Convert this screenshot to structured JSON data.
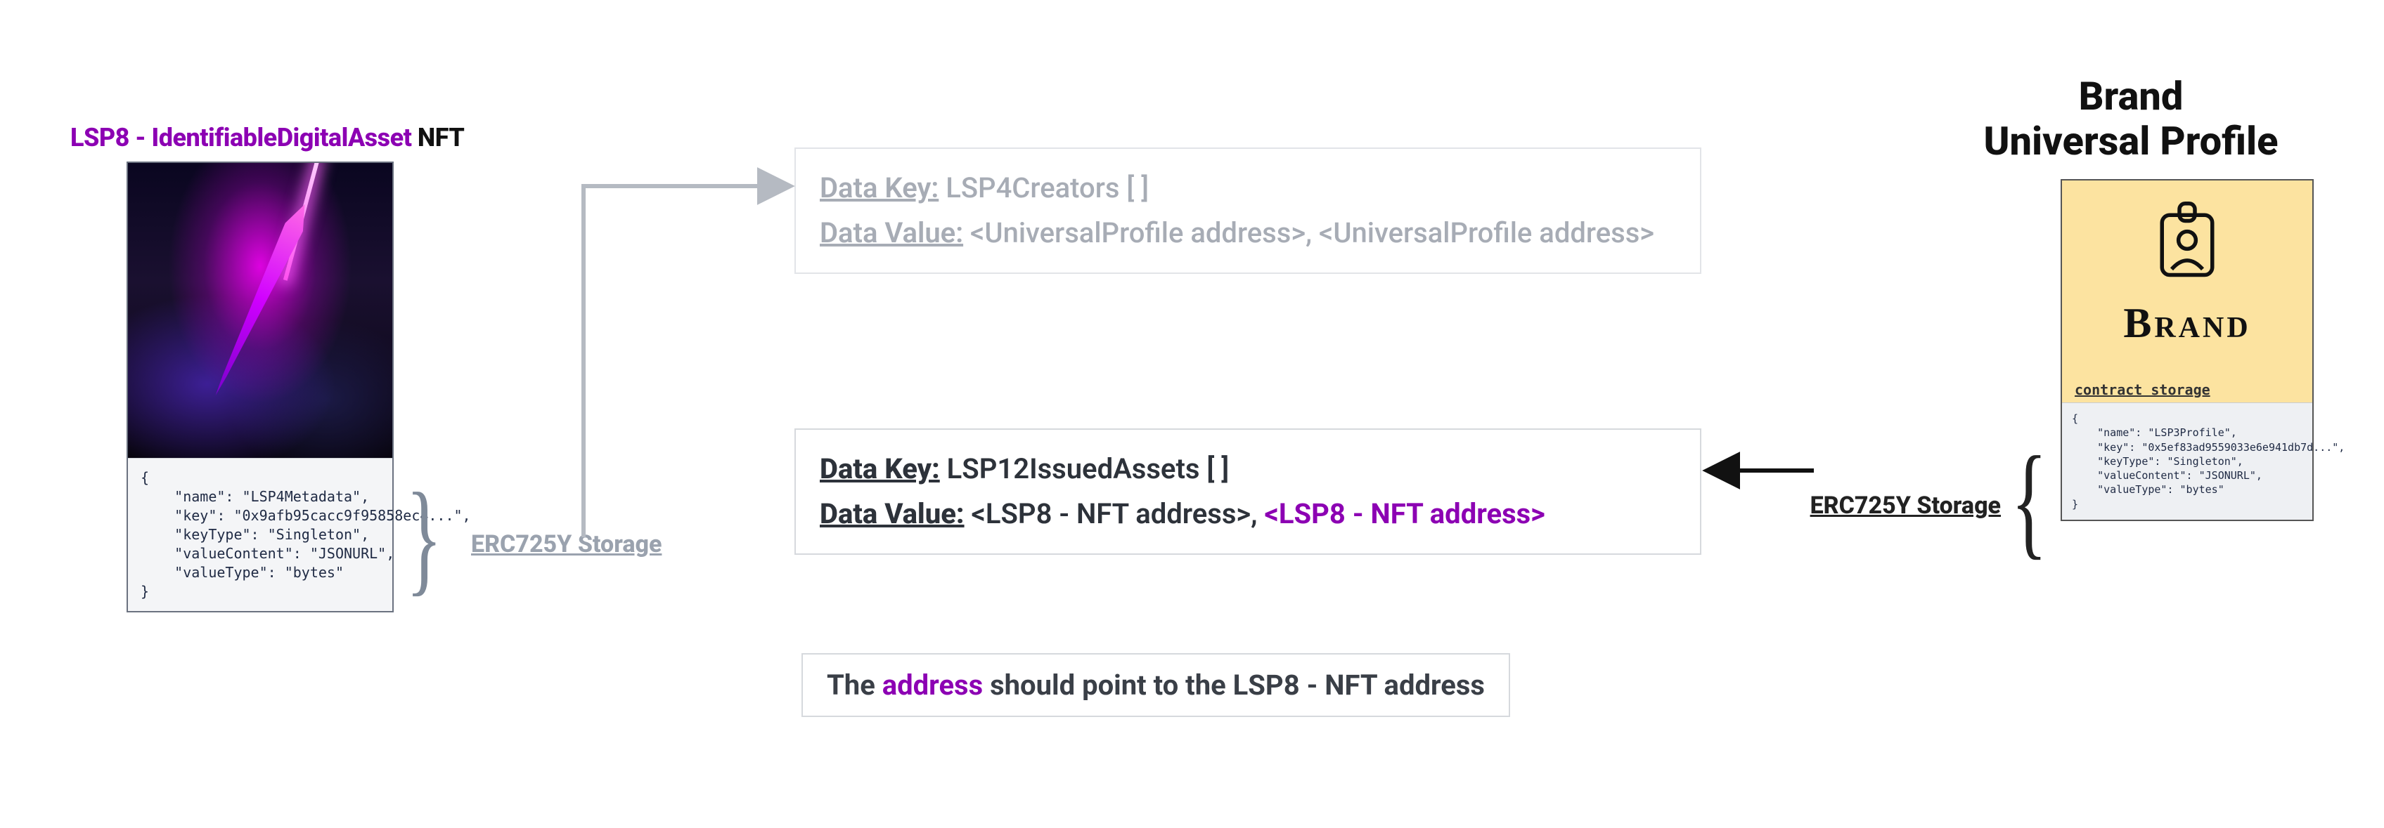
{
  "left": {
    "title_prefix": "LSP8 - IdentifiableDigitalAsset",
    "title_suffix": " NFT",
    "nft_json": "{\n    \"name\": \"LSP4Metadata\",\n    \"key\": \"0x9afb95cacc9f95858ec4...\",\n    \"keyType\": \"Singleton\",\n    \"valueContent\": \"JSONURL\",\n    \"valueType\": \"bytes\"\n}",
    "storage_label": "ERC725Y Storage"
  },
  "box_creators": {
    "key_label": "Data Key:",
    "key_value": " LSP4Creators [ ]",
    "val_label": "Data Value:",
    "val_value": " <UniversalProfile address>, <UniversalProfile address>"
  },
  "box_issued": {
    "key_label": "Data Key:",
    "key_value": " LSP12IssuedAssets [ ]",
    "val_label": "Data Value:",
    "val_value_a": " <LSP8 - NFT address>, ",
    "val_value_b": "<LSP8 - NFT address>"
  },
  "note": {
    "pre": "The ",
    "addr": "address",
    "post": " should point to the LSP8 - NFT address"
  },
  "right": {
    "title_line1": "Brand",
    "title_line2": "Universal Profile",
    "brand_word": "Brand",
    "contract_storage": "contract storage",
    "storage_label": "ERC725Y Storage",
    "up_json": "{\n    \"name\": \"LSP3Profile\",\n    \"key\": \"0x5ef83ad9559033e6e941db7d...\",\n    \"keyType\": \"Singleton\",\n    \"valueContent\": \"JSONURL\",\n    \"valueType\": \"bytes\"\n}"
  }
}
